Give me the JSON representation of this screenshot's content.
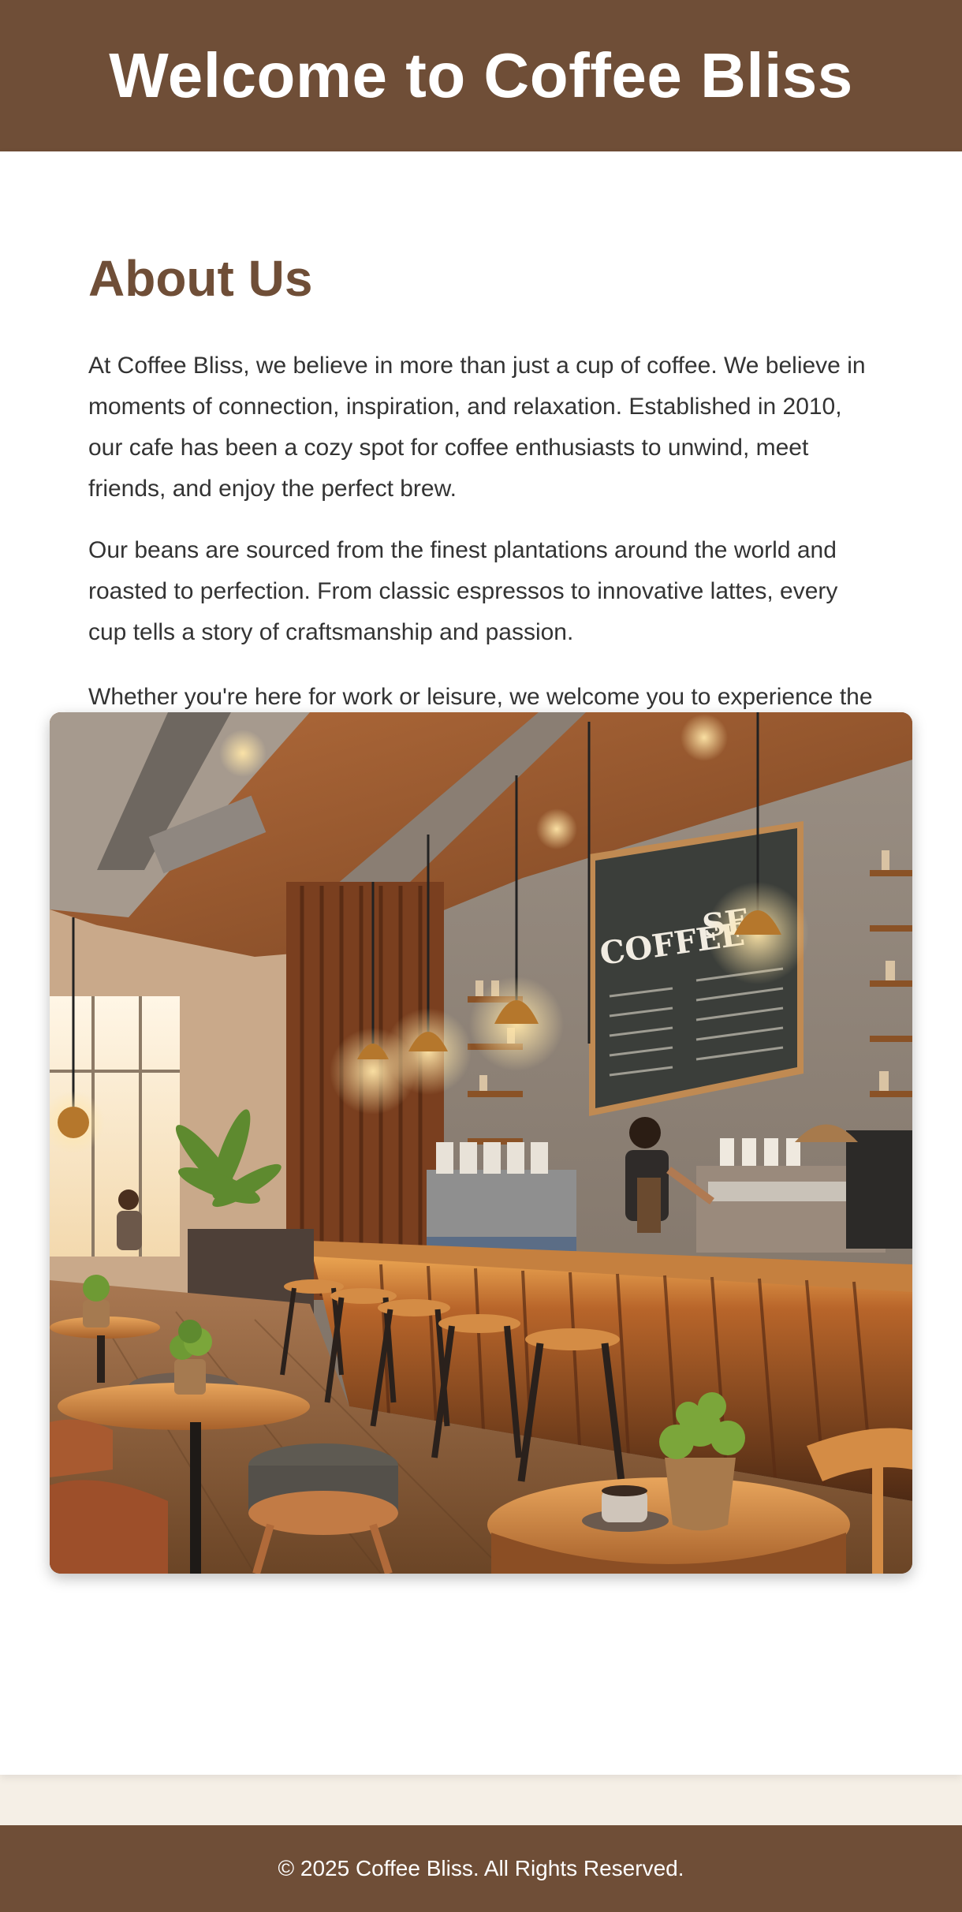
{
  "header": {
    "title": "Welcome to Coffee Bliss"
  },
  "about": {
    "heading": "About Us",
    "paragraphs": [
      "At Coffee Bliss, we believe in more than just a cup of coffee. We believe in moments of connection, inspiration, and relaxation. Established in 2010, our cafe has been a cozy spot for coffee enthusiasts to unwind, meet friends, and enjoy the perfect brew.",
      "Our beans are sourced from the finest plantations around the world and roasted to perfection. From classic espressos to innovative lattes, every cup tells a story of craftsmanship and passion.",
      "Whether you're here for work or leisure, we welcome you to experience the warm ambiance and exceptional service at Coffee Bliss."
    ]
  },
  "photo": {
    "chalkboard_title": "COFFEE",
    "chalkboard_title_2": "SE"
  },
  "footer": {
    "text": "© 2025 Coffee Bliss. All Rights Reserved."
  },
  "colors": {
    "brand_brown": "#6f4e37",
    "page_background": "#f5efe6",
    "card_background": "#ffffff"
  }
}
